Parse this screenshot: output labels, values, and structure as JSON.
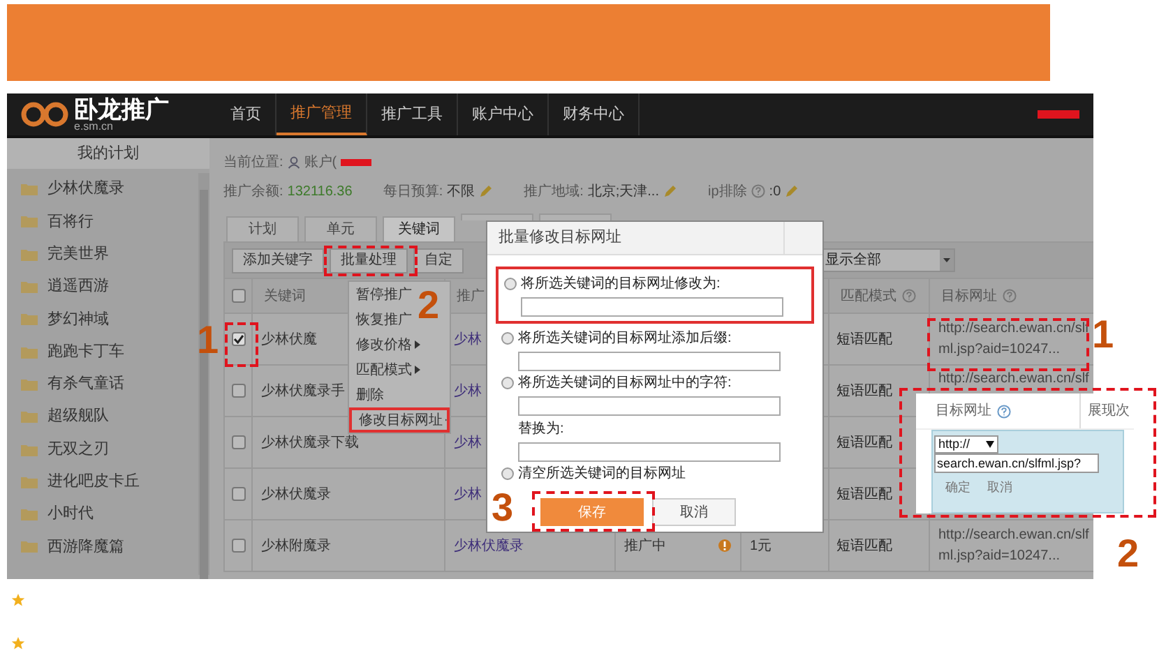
{
  "nav": {
    "logo": {
      "title": "卧龙推广",
      "subtitle": "e.sm.cn"
    },
    "items": [
      {
        "label": "首页",
        "selected": false
      },
      {
        "label": "推广管理",
        "selected": true
      },
      {
        "label": "推广工具",
        "selected": false
      },
      {
        "label": "账户中心",
        "selected": false
      },
      {
        "label": "财务中心",
        "selected": false
      }
    ]
  },
  "sidebar": {
    "title": "我的计划",
    "items": [
      "少林伏魔录",
      "百将行",
      "完美世界",
      "逍遥西游",
      "梦幻神域",
      "跑跑卡丁车",
      "有杀气童话",
      "超级舰队",
      "无双之刃",
      "进化吧皮卡丘",
      "小时代",
      "西游降魔篇"
    ]
  },
  "breadcrumb": {
    "label": "当前位置:",
    "account": "账户("
  },
  "stats": [
    {
      "kind": "money",
      "label": "推广余额:",
      "value": "132116.36"
    },
    {
      "kind": "edit",
      "label": "每日预算:",
      "value": "不限"
    },
    {
      "kind": "edit",
      "label": "推广地域:",
      "value": "北京;天津..."
    },
    {
      "kind": "help-edit",
      "label": "ip排除",
      "value": ":0"
    }
  ],
  "tabs": [
    {
      "label": "计划",
      "selected": false
    },
    {
      "label": "单元",
      "selected": false
    },
    {
      "label": "关键词",
      "selected": true
    },
    {
      "selected": false
    },
    {
      "selected": false
    }
  ],
  "toolbar": {
    "buttons": [
      "添加关键字",
      "批量处理",
      "自定"
    ],
    "filter": "显示全部"
  },
  "table": {
    "columns": [
      {
        "kind": "check",
        "checked": false
      },
      {
        "label": "关键词"
      },
      {
        "label": "推广"
      },
      {},
      {},
      {
        "label": "匹配模式",
        "help": true
      },
      {
        "label": "目标网址",
        "help": true
      }
    ],
    "rows": [
      {
        "checked": true,
        "keyword": "少林伏魔",
        "plan": "少林",
        "match": "短语匹配",
        "url": [
          "http://search.ewan.cn/slf",
          "ml.jsp?aid=10247..."
        ]
      },
      {
        "checked": false,
        "keyword": "少林伏魔录手",
        "plan": "少林",
        "match": "短语匹配",
        "url": [
          "http://search.ewan.cn/slf"
        ]
      },
      {
        "checked": false,
        "keyword": "少林伏魔录下载",
        "plan": "少林",
        "match": "短语匹配"
      },
      {
        "checked": false,
        "keyword": "少林伏魔录",
        "plan": "少林",
        "match": "短语匹配"
      },
      {
        "checked": false,
        "keyword": "少林附魔录",
        "plan": "少林伏魔录",
        "status": "推广中",
        "price": "1元",
        "match": "短语匹配",
        "url": [
          "http://search.ewan.cn/slf",
          "ml.jsp?aid=10247..."
        ]
      }
    ]
  },
  "batch_menu": [
    {
      "label": "暂停推广",
      "submenu": false
    },
    {
      "label": "恢复推广",
      "submenu": false
    },
    {
      "label": "修改价格",
      "submenu": true
    },
    {
      "label": "匹配模式",
      "submenu": true
    },
    {
      "label": "删除",
      "submenu": false
    },
    {
      "label": "修改目标网址",
      "submenu": true
    }
  ],
  "dialog": {
    "title": "批量修改目标网址",
    "options": [
      {
        "kind": "input",
        "label": "将所选关键词的目标网址修改为:",
        "selected": false
      },
      {
        "kind": "input",
        "label": "将所选关键词的目标网址添加后缀:",
        "selected": false
      },
      {
        "kind": "replace",
        "label": "将所选关键词的目标网址中的字符:",
        "selected": false,
        "replace_label": "替换为:"
      },
      {
        "kind": "clear",
        "label": "清空所选关键词的目标网址",
        "selected": false
      }
    ],
    "save": "保存",
    "cancel": "取消"
  },
  "inset": {
    "column": "目标网址",
    "next_column": "展现次",
    "protocol": "http://",
    "url": "search.ewan.cn/slfml.jsp?",
    "confirm": "确定",
    "cancel": "取消"
  },
  "annotations": [
    "1",
    "2",
    "3",
    "1",
    "2"
  ]
}
